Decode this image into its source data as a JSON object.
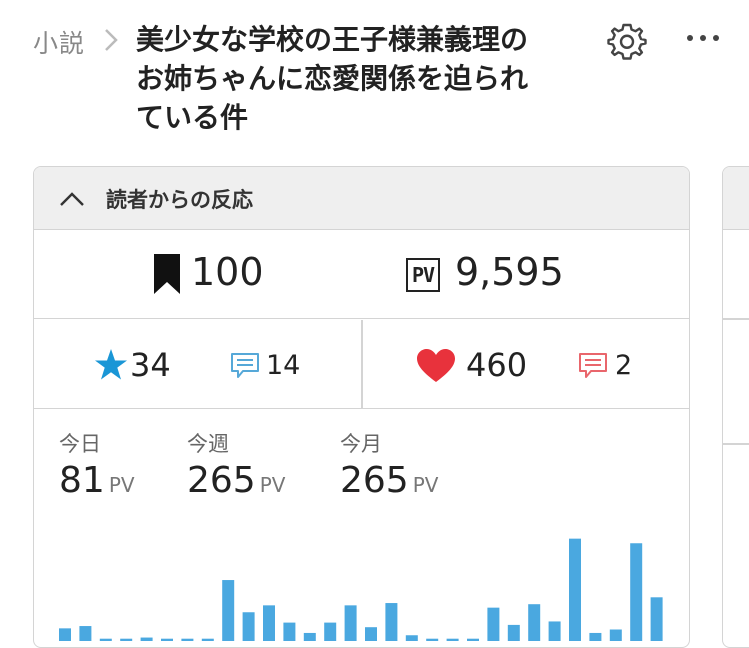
{
  "header": {
    "breadcrumb": "小説",
    "title_lines": [
      "美少女な学校の王子様兼義理の",
      "お姉ちゃんに恋愛関係を迫られ",
      "ている件"
    ]
  },
  "reactions": {
    "title": "読者からの反応",
    "bookmarks": "100",
    "pv_badge": "PV",
    "pv_total": "9,595",
    "stars": "34",
    "star_comments": "14",
    "hearts": "460",
    "heart_comments": "2"
  },
  "stats": {
    "today_label": "今日",
    "today_value": "81",
    "week_label": "今週",
    "week_value": "265",
    "month_label": "今月",
    "month_value": "265",
    "unit": "PV"
  },
  "colors": {
    "accent_blue": "#1a96d6",
    "comment_blue": "#56a8d8",
    "heart_red": "#e8323c",
    "comment_red": "#e9666c",
    "bar_blue": "#4aa8e0"
  },
  "chart_data": {
    "type": "bar",
    "title": "",
    "series": [
      {
        "values": [
          11,
          13,
          2,
          2,
          3,
          2,
          2,
          2,
          53,
          25,
          31,
          16,
          7,
          16,
          31,
          12,
          33,
          5,
          2,
          2,
          2,
          29,
          14,
          32,
          17,
          89,
          7,
          10,
          85,
          38
        ]
      }
    ],
    "ylim": [
      0,
      100
    ]
  }
}
